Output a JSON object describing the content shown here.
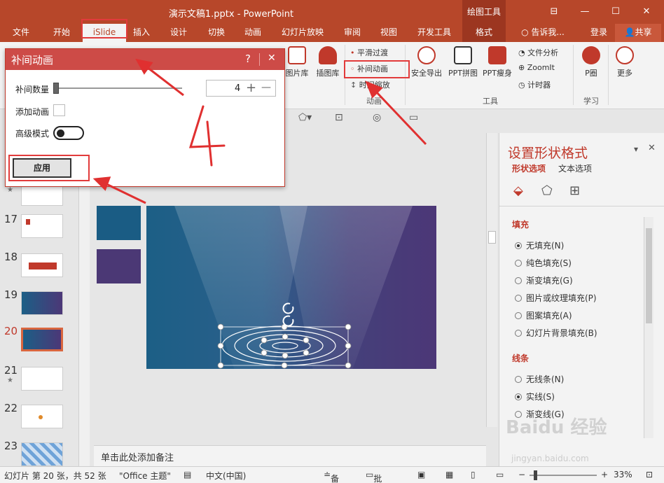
{
  "window": {
    "title": "演示文稿1.pptx - PowerPoint",
    "context_group": "绘图工具",
    "minimize": "—",
    "maximize": "☐",
    "close": "✕",
    "restore": "⊟"
  },
  "tabs": [
    {
      "label": "文件"
    },
    {
      "label": "开始"
    },
    {
      "label": "iSlide"
    },
    {
      "label": "插入"
    },
    {
      "label": "设计"
    },
    {
      "label": "切换"
    },
    {
      "label": "动画"
    },
    {
      "label": "幻灯片放映"
    },
    {
      "label": "审阅"
    },
    {
      "label": "视图"
    },
    {
      "label": "开发工具"
    },
    {
      "label": "格式"
    }
  ],
  "tellme": "告诉我...",
  "login": "登录",
  "share": "共享",
  "ribbon": {
    "picture_lib": "图片库",
    "illustration_lib": "插图库",
    "smooth_transition": "平滑过渡",
    "tween_animation": "补间动画",
    "time_scale": "时间缩放",
    "animation_group": "动画",
    "safe_export": "安全导出",
    "ppt_collage": "PPT拼图",
    "ppt_slim": "PPT瘦身",
    "file_analysis": "文件分析",
    "zoomit": "ZoomIt",
    "timer": "计时器",
    "tools_group": "工具",
    "p_circle": "P圈",
    "learn_group": "学习",
    "more": "更多"
  },
  "dialog": {
    "title": "补间动画",
    "help": "?",
    "close": "✕",
    "count_label": "补间数量",
    "count_value": "4",
    "plus": "+",
    "minus": "—",
    "add_anim_label": "添加动画",
    "advanced_label": "高级模式",
    "apply": "应用"
  },
  "annotation": "4",
  "thumbnails": [
    {
      "num": "17"
    },
    {
      "num": "18"
    },
    {
      "num": "19"
    },
    {
      "num": "20"
    },
    {
      "num": "21"
    },
    {
      "num": "22"
    },
    {
      "num": "23"
    }
  ],
  "star": "★",
  "notes_placeholder": "单击此处添加备注",
  "format_pane": {
    "title": "设置形状格式",
    "tab_shape": "形状选项",
    "tab_text": "文本选项",
    "fill_section": "填充",
    "fill_options": [
      "无填充(N)",
      "纯色填充(S)",
      "渐变填充(G)",
      "图片或纹理填充(P)",
      "图案填充(A)",
      "幻灯片背景填充(B)"
    ],
    "line_section": "线条",
    "line_options": [
      "无线条(N)",
      "实线(S)",
      "渐变线(G)"
    ]
  },
  "status": {
    "slide_info": "幻灯片 第 20 张，共 52 张",
    "theme": "\"Office 主题\"",
    "language": "中文(中国)",
    "notes": "备注",
    "comments": "批注",
    "zoom": "33%"
  },
  "watermark": "Baidu 经验",
  "watermark_url": "jingyan.baidu.com",
  "colors": {
    "accent": "#b7472a",
    "dialog_header": "#cd4b47",
    "annotation": "#e03030",
    "slide_left": "#1c5f86",
    "slide_right": "#4c3777"
  }
}
